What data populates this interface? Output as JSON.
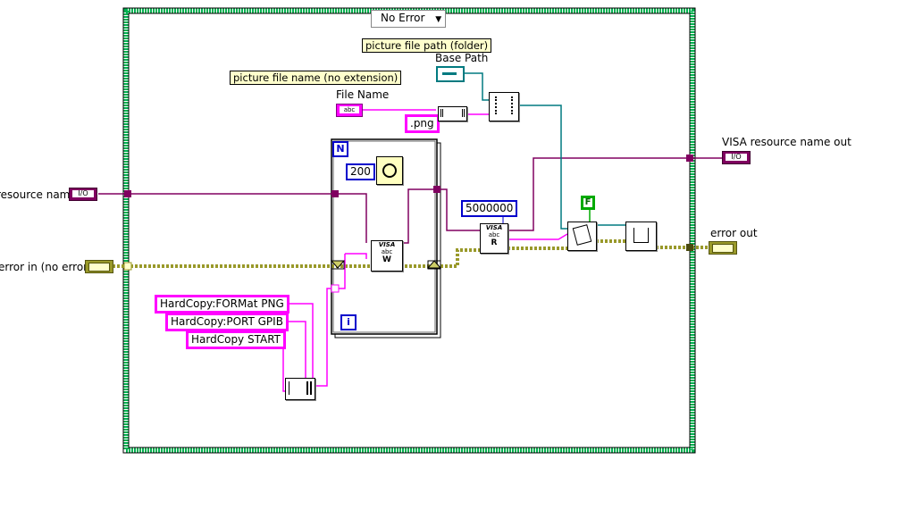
{
  "case_selector": {
    "value": "No Error",
    "arrow": "▼"
  },
  "comments": {
    "folder": "picture file path (folder)",
    "filename": "picture file name (no extension)"
  },
  "labels": {
    "base_path": "Base Path",
    "file_name": "File Name",
    "resource_in": "resource name",
    "error_in": "error in (no error)",
    "visa_out": "VISA resource name out",
    "error_out": "error out"
  },
  "constants": {
    "ext": ".png",
    "wait_ms": "200",
    "read_count": "5000000",
    "bool_false": "F",
    "cmd1": "HardCopy:FORMat PNG",
    "cmd2": "HardCopy:PORT GPIB",
    "cmd3": "HardCopy START"
  },
  "for_loop": {
    "count_terminal": "N",
    "iteration_terminal": "i"
  },
  "terminals": {
    "io": "I/O",
    "abc": "abc",
    "visa_write": "VISA",
    "visa_read": "VISA"
  },
  "colors": {
    "frame_green": "#00b050",
    "string_wire": "#ff00ff",
    "visa_wire": "#800060",
    "error_wire": "#99992a",
    "path_wire": "#007a80",
    "numeric_blue": "#0000cc"
  }
}
